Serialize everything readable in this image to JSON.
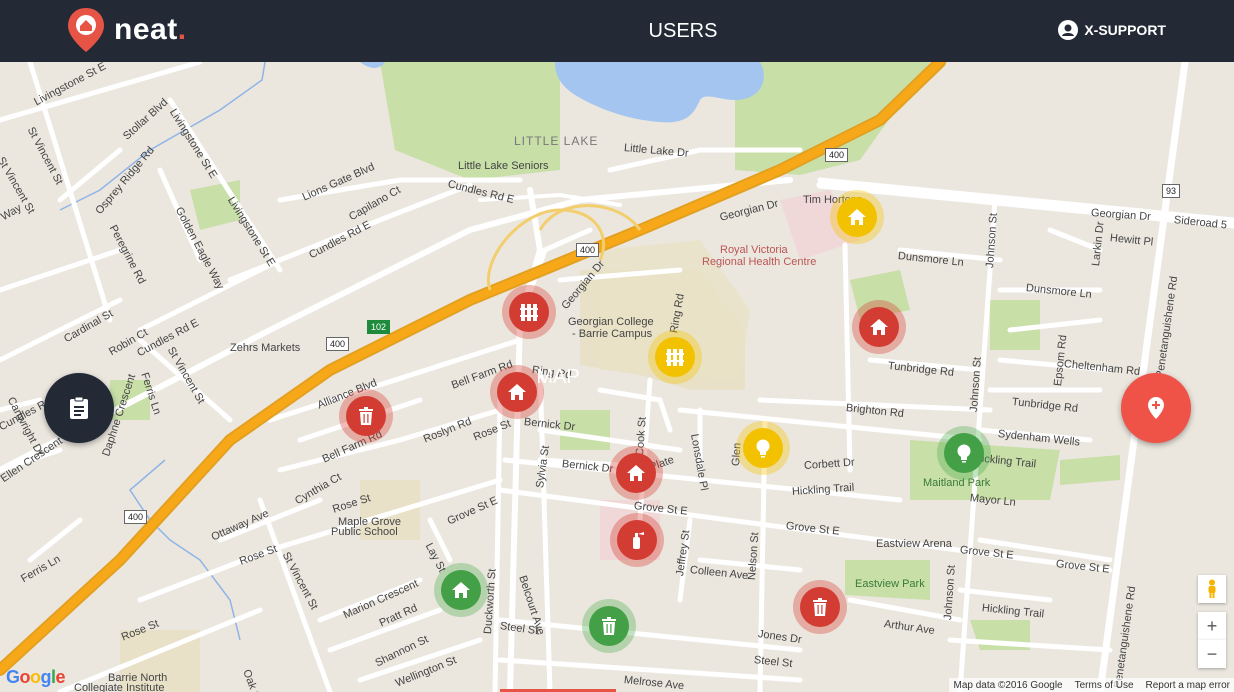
{
  "app": {
    "logo_text": "neat",
    "logo_dot": "."
  },
  "nav": {
    "tabs": [
      {
        "label": "MAP"
      },
      {
        "label": "USERS"
      }
    ]
  },
  "account": {
    "name": "X-SUPPORT"
  },
  "map": {
    "labels": {
      "livingstone1": "Livingstone St E",
      "livingstone2": "Livingstone St E",
      "livingstone3": "Livingstone St E",
      "stollar": "Stollar Blvd",
      "stvincent1": "St Vincent St",
      "stvincent2": "St Vincent St",
      "stvincent3": "St Vincent St",
      "osprey": "Osprey Ridge Rd",
      "peregrine": "Peregrine Rd",
      "golden": "Golden Eagle Way",
      "lions": "Lions Gate Blvd",
      "capilano": "Capilano Ct",
      "cundles1": "Cundles Rd E",
      "cundles2": "Cundles Rd E",
      "cundles3": "Cundles Rd E",
      "littlelake": "LITTLE LAKE",
      "littlelakeseniors": "Little Lake Seniors",
      "littlelakedr": "Little Lake Dr",
      "georgian1": "Georgian Dr",
      "georgian2": "Georgian Dr",
      "georgian3": "Georgian Dr",
      "timhortons": "Tim Hortons",
      "rvh1": "Royal Victoria",
      "rvh2": "Regional Health Centre",
      "college1": "Georgian College",
      "college2": "- Barrie Campus",
      "ring1": "Ring Rd",
      "ring2": "Ring Rd",
      "zehrs": "Zehrs Markets",
      "cardinal": "Cardinal St",
      "robin": "Robin Ct",
      "ferris1": "Ferris Ln",
      "ferris2": "Ferris Ln",
      "alliance": "Alliance Blvd",
      "bellfarm1": "Bell Farm Rd",
      "bellfarm2": "Bell Farm Rd",
      "roslyn": "Roslyn Rd",
      "rose1": "Rose St",
      "rose2": "Rose St",
      "rose3": "Rose St",
      "rose4": "Rose St",
      "bernick1": "Bernick Dr",
      "bernick2": "Bernick Dr",
      "cynthia": "Cynthia Ct",
      "maplegrove1": "Maple Grove",
      "maplegrove2": "Public School",
      "grove1": "Grove St E",
      "grove2": "Grove St E",
      "grove3": "Grove St E",
      "grove4": "Grove St E",
      "grove5": "Grove St E",
      "ottaway": "Ottaway Ave",
      "marion": "Marion Crescent",
      "pratt": "Pratt Rd",
      "shannon": "Shannon St",
      "wellington": "Wellington St",
      "barrienorth1": "Barrie North",
      "barrienorth2": "Collegiate Institute",
      "oak": "Oak St",
      "duckworth": "Duckworth St",
      "sylvia": "Sylvia St",
      "lay": "Lay St",
      "belcourt": "Belcourt Ave",
      "steel1": "Steel St",
      "steel2": "Steel St",
      "melrose": "Melrose Ave",
      "cook": "Cook St",
      "lonsdale": "Lonsdale Pl",
      "jeffrey": "Jeffrey St",
      "colleen": "Colleen Ave",
      "nelson": "Nelson St",
      "jones": "Jones Dr",
      "arthur": "Arthur Ave",
      "eastviewarena": "Eastview Arena",
      "eastviewpark": "Eastview Park",
      "hickling1": "Hickling Trail",
      "hickling2": "Hickling Trail",
      "hickling3": "Hickling Trail",
      "corbett": "Corbett Dr",
      "mayor": "Mayor Ln",
      "maitland": "Maitland Park",
      "sydenham": "Sydenham Wells",
      "brighton": "Brighton Rd",
      "tunbridge1": "Tunbridge Rd",
      "tunbridge2": "Tunbridge Rd",
      "cheltenham": "Cheltenham Rd",
      "epsom": "Epsom Rd",
      "johnson1": "Johnson St",
      "johnson2": "Johnson St",
      "johnson3": "Johnson St",
      "dunsmore1": "Dunsmore Ln",
      "dunsmore2": "Dunsmore Ln",
      "larkin": "Larkin Dr",
      "hewitt": "Hewitt Pl",
      "penetang1": "Penetanguishene Rd",
      "penetang2": "Penetanguishene Rd",
      "sideroad": "Sideroad 5",
      "cartwright": "Cartwright Dr",
      "daphne": "Daphne Crescent",
      "ellen": "Ellen Crescent",
      "way": "Way",
      "stve": "St Vincent St",
      "cundles0": "Cundles Rd",
      "glen": "Glen",
      "plate": "Plate"
    },
    "shields": {
      "h400_1": "400",
      "h400_2": "400",
      "h400_3": "400",
      "h400_4": "400",
      "h102": "102",
      "h93": "93"
    },
    "markers": [
      {
        "type": "fence",
        "color": "red"
      },
      {
        "type": "fence",
        "color": "yellow"
      },
      {
        "type": "house",
        "color": "yellow"
      },
      {
        "type": "house",
        "color": "red"
      },
      {
        "type": "house",
        "color": "red"
      },
      {
        "type": "trash",
        "color": "red"
      },
      {
        "type": "bulb",
        "color": "yellow"
      },
      {
        "type": "bulb",
        "color": "green"
      },
      {
        "type": "house",
        "color": "red"
      },
      {
        "type": "extinguisher",
        "color": "red"
      },
      {
        "type": "house",
        "color": "green"
      },
      {
        "type": "trash",
        "color": "green"
      },
      {
        "type": "trash",
        "color": "red"
      }
    ],
    "attribution": {
      "data": "Map data ©2016 Google",
      "terms": "Terms of Use",
      "report": "Report a map error"
    },
    "google": "Google",
    "zoom_in": "+",
    "zoom_out": "−"
  },
  "colors": {
    "header": "#232a35",
    "accent": "#e65446",
    "red": "#d23c32",
    "yellow": "#f2c200",
    "green": "#43a047"
  }
}
